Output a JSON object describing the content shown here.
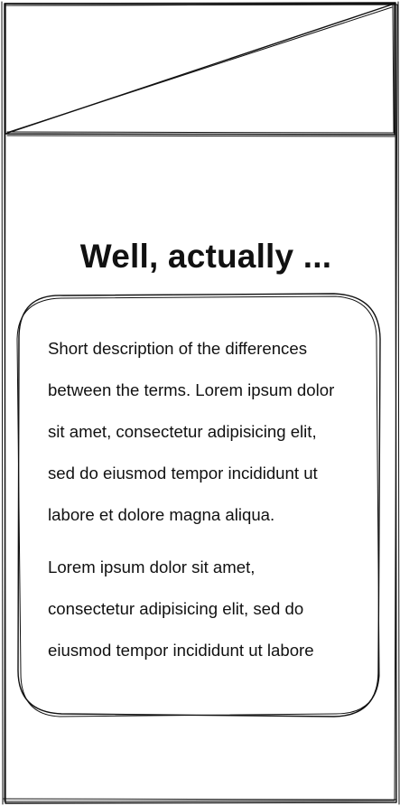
{
  "header": {
    "image_placeholder": "image-placeholder-icon"
  },
  "main": {
    "title": "Well, actually ...",
    "card": {
      "paragraph1": [
        "Short description of the differences",
        "between the terms. Lorem ipsum dolor",
        "sit amet, consectetur adipisicing elit,",
        "sed do eiusmod tempor incididunt ut",
        "labore et dolore magna aliqua."
      ],
      "paragraph2": [
        "Lorem ipsum dolor sit amet,",
        "consectetur adipisicing elit, sed do",
        "eiusmod tempor incididunt ut labore"
      ]
    }
  },
  "colors": {
    "ink": "#111111",
    "background": "#ffffff"
  }
}
